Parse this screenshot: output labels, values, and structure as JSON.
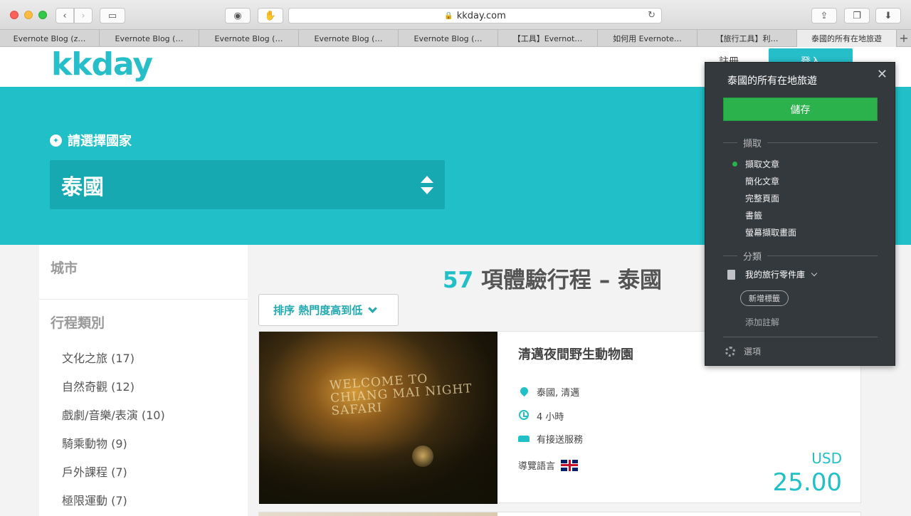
{
  "browser": {
    "url": "kkday.com",
    "tabs": [
      {
        "label": "Evernote Blog (z…",
        "active": false
      },
      {
        "label": "Evernote Blog (…",
        "active": false
      },
      {
        "label": "Evernote Blog (…",
        "active": false
      },
      {
        "label": "Evernote Blog (…",
        "active": false
      },
      {
        "label": "Evernote Blog (…",
        "active": false
      },
      {
        "label": "【工具】Evernot…",
        "active": false
      },
      {
        "label": "如何用 Evernote…",
        "active": false
      },
      {
        "label": "【旅行工具】利…",
        "active": false
      },
      {
        "label": "泰國的所有在地旅遊",
        "active": true
      }
    ]
  },
  "site": {
    "logo": "kkday",
    "header_link": "註冊",
    "login": "登入"
  },
  "hero": {
    "country_label": "請選擇國家",
    "selected_country": "泰國"
  },
  "filters": {
    "city_title": "城市",
    "category_title": "行程類別",
    "categories": [
      "文化之旅 (17)",
      "自然奇觀 (12)",
      "戲劇/音樂/表演 (10)",
      "騎乘動物 (9)",
      "戶外課程 (7)",
      "極限運動 (7)"
    ]
  },
  "results": {
    "count": "57",
    "title_rest": "項體驗行程 – 泰國",
    "sort_label": "排序 熱門度高到低"
  },
  "card": {
    "image_sign": "WELCOME TO\nCHIANG MAI NIGHT\nSAFARI",
    "title": "清邁夜間野生動物園",
    "location": "泰國, 清邁",
    "duration": "4 小時",
    "transfer": "有接送服務",
    "language_label": "導覽語言",
    "currency": "USD",
    "price": "25.00"
  },
  "evernote": {
    "title": "泰國的所有在地旅遊",
    "save": "儲存",
    "capture_section": "擷取",
    "capture_options": [
      "擷取文章",
      "簡化文章",
      "完整頁面",
      "書籤",
      "螢幕擷取畫面"
    ],
    "selected_option": "擷取文章",
    "category_section": "分類",
    "notebook": "我的旅行零件庫",
    "add_tag": "新增標籤",
    "add_remark": "添加註解",
    "options": "選項"
  },
  "colors": {
    "brand_teal": "#21c0c8",
    "evernote_green": "#2bb24c",
    "popup_bg": "#34393d"
  }
}
